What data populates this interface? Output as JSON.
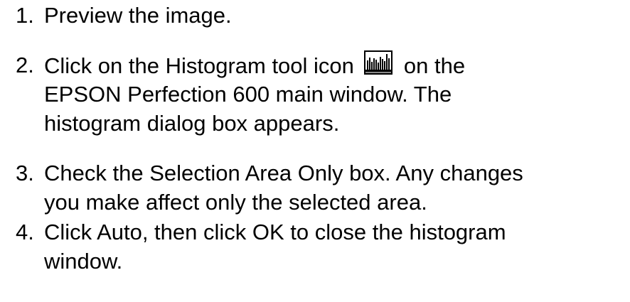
{
  "steps": [
    {
      "number": "1.",
      "lines": [
        "Preview the image."
      ]
    },
    {
      "number": "2.",
      "line1_before_icon": "Click on the Histogram tool icon",
      "line1_after_icon": "on the",
      "icon": "histogram-tool-icon",
      "lines_rest": [
        "EPSON Perfection 600 main window. The",
        "histogram dialog box appears."
      ]
    },
    {
      "number": "3.",
      "lines": [
        "Check the Selection Area Only box. Any changes",
        "you make affect only the selected area."
      ]
    },
    {
      "number": "4.",
      "lines": [
        "Click Auto, then click OK to close the histogram",
        "window."
      ]
    }
  ]
}
